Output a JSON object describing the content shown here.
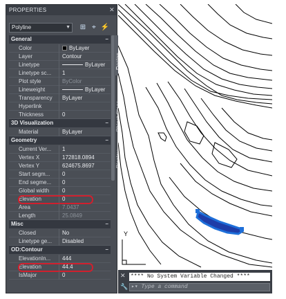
{
  "palette": {
    "title": "PROPERTIES",
    "object_select": "Polyline",
    "tabs": [
      "Design",
      "Object Class",
      "Display"
    ]
  },
  "sections": [
    {
      "title": "General",
      "toggle": "–",
      "rows": [
        {
          "label": "Color",
          "value": "ByLayer",
          "swatch": "#000000"
        },
        {
          "label": "Layer",
          "value": "Contour"
        },
        {
          "label": "Linetype",
          "value": "ByLayer",
          "line": true
        },
        {
          "label": "Linetype sc...",
          "value": "1"
        },
        {
          "label": "Plot style",
          "value": "ByColor",
          "dim": true
        },
        {
          "label": "Lineweight",
          "value": "ByLayer",
          "line": true
        },
        {
          "label": "Transparency",
          "value": "ByLayer"
        },
        {
          "label": "Hyperlink",
          "value": ""
        },
        {
          "label": "Thickness",
          "value": "0"
        }
      ]
    },
    {
      "title": "3D Visualization",
      "toggle": "–",
      "rows": [
        {
          "label": "Material",
          "value": "ByLayer"
        }
      ]
    },
    {
      "title": "Geometry",
      "toggle": "–",
      "rows": [
        {
          "label": "Current Ver...",
          "value": "1"
        },
        {
          "label": "Vertex X",
          "value": "172818.0894"
        },
        {
          "label": "Vertex Y",
          "value": "624675.8697"
        },
        {
          "label": "Start segm...",
          "value": "0"
        },
        {
          "label": "End segme...",
          "value": "0"
        },
        {
          "label": "Global width",
          "value": "0"
        },
        {
          "label": "Elevation",
          "value": "0",
          "highlight": true
        },
        {
          "label": "Area",
          "value": "7.0437",
          "dim": true
        },
        {
          "label": "Length",
          "value": "25.0849",
          "dim": true
        }
      ]
    },
    {
      "title": "Misc",
      "toggle": "–",
      "rows": [
        {
          "label": "Closed",
          "value": "No"
        },
        {
          "label": "Linetype ge...",
          "value": "Disabled"
        }
      ]
    },
    {
      "title": "OD:Contour",
      "toggle": "–",
      "rows": [
        {
          "label": "ElevationIn...",
          "value": "444"
        },
        {
          "label": "Elevation",
          "value": "44.4",
          "highlight": true
        },
        {
          "label": "IsMajor",
          "value": "0"
        }
      ]
    }
  ],
  "drawing": {
    "ucs_y_label": "Y",
    "selection_color": "#1e6fd9"
  },
  "command": {
    "history": "**** No System Variable Changed ****",
    "prompt_placeholder": "Type a command"
  },
  "colors": {
    "palette_bg": "#4a4e55",
    "highlight": "#d11f2d"
  }
}
